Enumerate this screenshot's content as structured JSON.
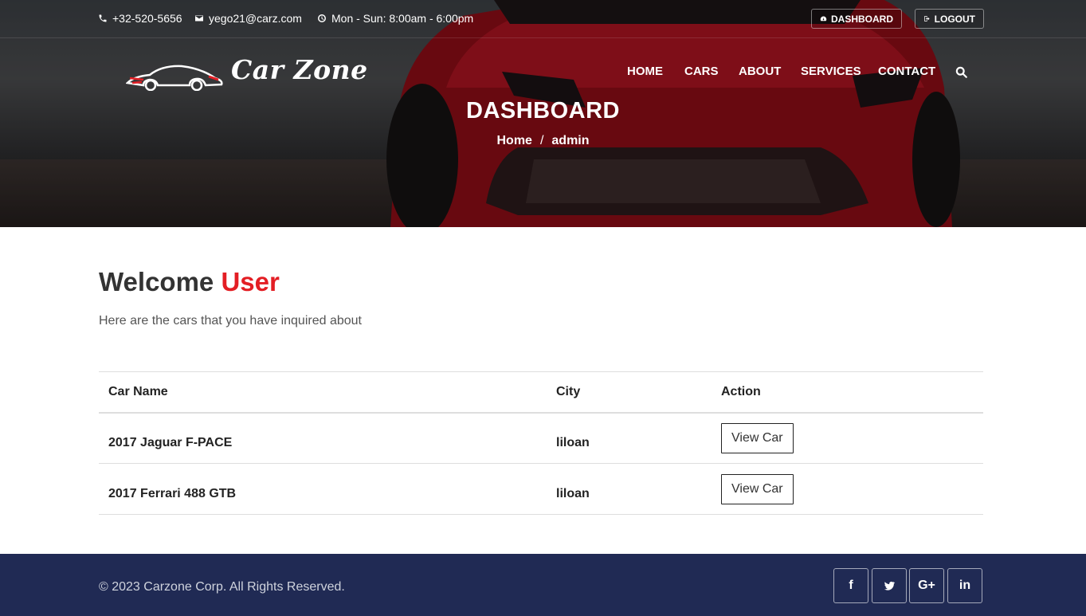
{
  "topbar": {
    "phone": "+32-520-5656",
    "email": "yego21@carz.com",
    "hours": "Mon - Sun: 8:00am - 6:00pm",
    "dashboard_label": "DASHBOARD",
    "logout_label": "LOGOUT"
  },
  "brand": {
    "name": "Car Zone"
  },
  "nav": {
    "items": [
      {
        "label": "HOME"
      },
      {
        "label": "CARS"
      },
      {
        "label": "ABOUT"
      },
      {
        "label": "SERVICES"
      },
      {
        "label": "CONTACT"
      }
    ]
  },
  "hero": {
    "title": "DASHBOARD",
    "breadcrumb": {
      "home": "Home",
      "separator": "/",
      "current": "admin"
    }
  },
  "main": {
    "welcome_prefix": "Welcome",
    "welcome_name": "User",
    "intro": "Here are the cars that you have inquired about",
    "table": {
      "headers": {
        "car_name": "Car Name",
        "city": "City",
        "action": "Action"
      },
      "rows": [
        {
          "car_name": "2017 Jaguar F-PACE",
          "city": "liloan",
          "action": "View Car"
        },
        {
          "car_name": "2017 Ferrari 488 GTB",
          "city": "liloan",
          "action": "View Car"
        }
      ]
    }
  },
  "footer": {
    "copyright": "© 2023 Carzone Corp. All Rights Reserved.",
    "social": [
      {
        "icon": "facebook-icon",
        "glyph": "f"
      },
      {
        "icon": "twitter-icon",
        "glyph": ""
      },
      {
        "icon": "google-plus-icon",
        "glyph": "G+"
      },
      {
        "icon": "linkedin-icon",
        "glyph": "in"
      }
    ]
  },
  "colors": {
    "accent": "#e31e24",
    "footer_bg": "#202a54",
    "text": "#333333"
  }
}
